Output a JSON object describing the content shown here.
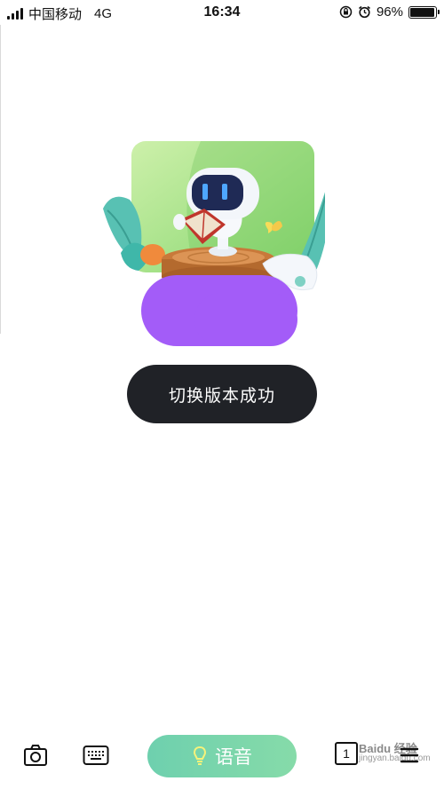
{
  "status_bar": {
    "carrier": "中国移动",
    "network": "4G",
    "time": "16:34",
    "battery_percent": "96%",
    "battery_level": 0.96
  },
  "toast": {
    "message": "切换版本成功"
  },
  "bottom_bar": {
    "voice_label": "语音",
    "page_count": "1",
    "accent_color": "#7ad6ac"
  },
  "watermark": {
    "title": "Baidu 经验",
    "url": "jingyan.baidu.com"
  },
  "colors": {
    "card_green": "#9fdf7c",
    "purple": "#a35cf8",
    "toast_bg": "#202227"
  },
  "icons": [
    "camera-icon",
    "keyboard-icon",
    "bulb-icon",
    "page-count-icon",
    "menu-icon"
  ]
}
